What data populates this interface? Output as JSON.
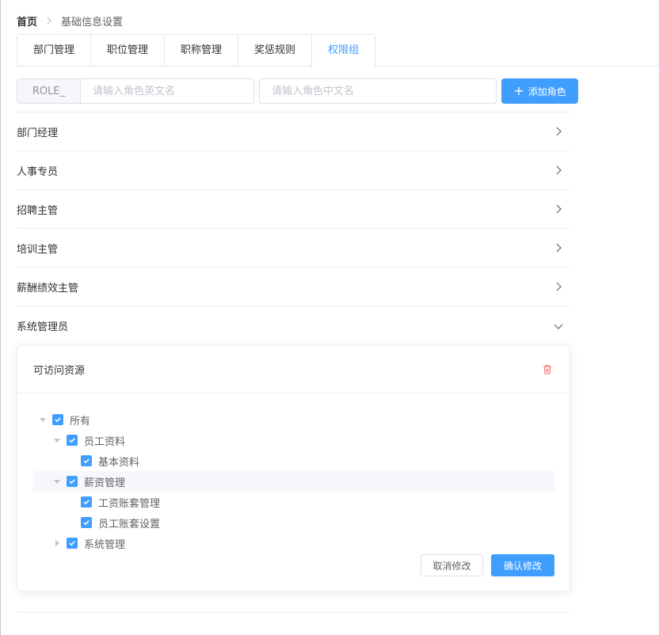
{
  "breadcrumb": {
    "home": "首页",
    "current": "基础信息设置"
  },
  "tabs": [
    {
      "label": "部门管理"
    },
    {
      "label": "职位管理"
    },
    {
      "label": "职称管理"
    },
    {
      "label": "奖惩规则"
    },
    {
      "label": "权限组",
      "active": true
    }
  ],
  "role_form": {
    "prefix": "ROLE_",
    "en_placeholder": "请输入角色英文名",
    "cn_placeholder": "请输入角色中文名",
    "add_label": "添加角色"
  },
  "roles": [
    {
      "name": "部门经理",
      "expanded": false
    },
    {
      "name": "人事专员",
      "expanded": false
    },
    {
      "name": "招聘主管",
      "expanded": false
    },
    {
      "name": "培训主管",
      "expanded": false
    },
    {
      "name": "薪酬绩效主管",
      "expanded": false
    },
    {
      "name": "系统管理员",
      "expanded": true
    }
  ],
  "panel": {
    "title": "可访问资源",
    "cancel_label": "取消修改",
    "confirm_label": "确认修改"
  },
  "tree": [
    {
      "label": "所有",
      "level": 0,
      "caret": "down",
      "checked": true
    },
    {
      "label": "员工资料",
      "level": 1,
      "caret": "down",
      "checked": true
    },
    {
      "label": "基本资料",
      "level": 2,
      "caret": "none",
      "checked": true
    },
    {
      "label": "薪资管理",
      "level": 1,
      "caret": "down",
      "checked": true,
      "highlighted": true
    },
    {
      "label": "工资账套管理",
      "level": 2,
      "caret": "none",
      "checked": true
    },
    {
      "label": "员工账套设置",
      "level": 2,
      "caret": "none",
      "checked": true
    },
    {
      "label": "系统管理",
      "level": 1,
      "caret": "right",
      "checked": true
    }
  ],
  "colors": {
    "primary": "#409eff",
    "danger": "#f56c6c",
    "border": "#ebeef5"
  }
}
